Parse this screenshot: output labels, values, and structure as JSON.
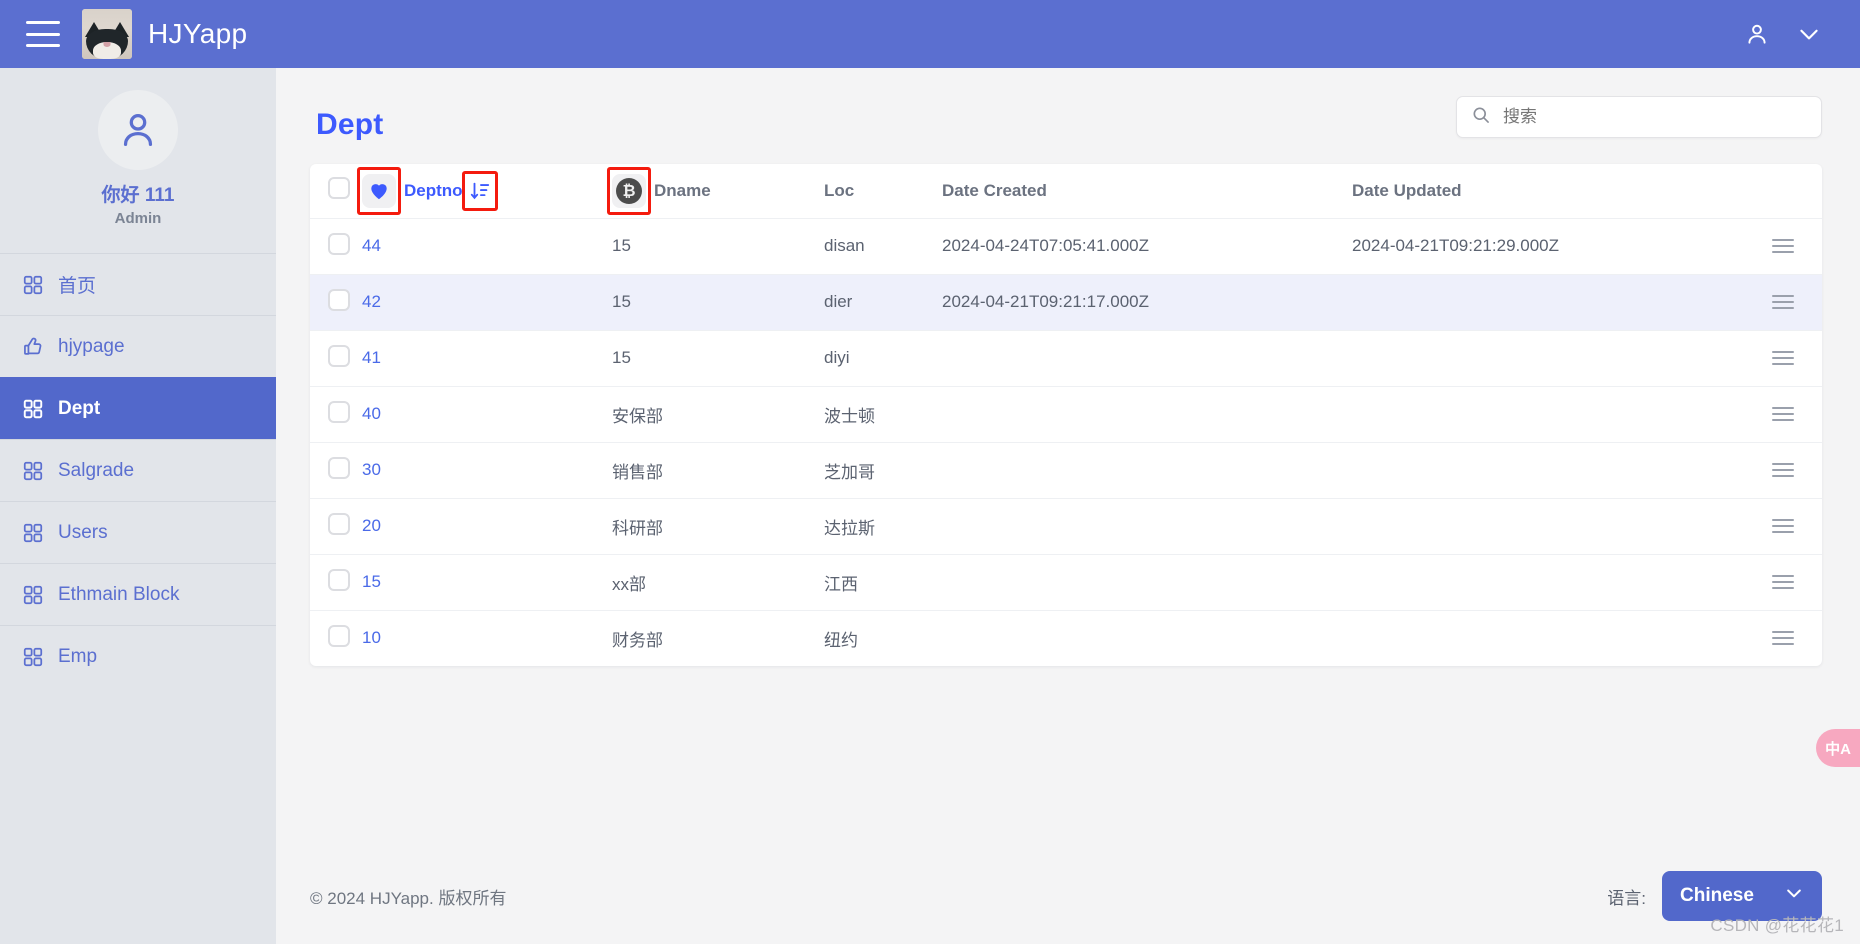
{
  "topbar": {
    "menu_icon": "hamburger-icon",
    "logo_alt": "cat-logo",
    "title": "HJYapp",
    "account_icon": "person-icon",
    "caret_icon": "chevron-down-icon"
  },
  "sidebar": {
    "avatar_icon": "person-icon",
    "user_name": "你好 111",
    "user_role": "Admin",
    "items": [
      {
        "label": "首页",
        "icon": "grid-icon",
        "active": false
      },
      {
        "label": "hjypage",
        "icon": "thumbs-up-icon",
        "active": false
      },
      {
        "label": "Dept",
        "icon": "grid-icon",
        "active": true
      },
      {
        "label": "Salgrade",
        "icon": "grid-icon",
        "active": false
      },
      {
        "label": "Users",
        "icon": "grid-icon",
        "active": false
      },
      {
        "label": "Ethmain Block",
        "icon": "grid-icon",
        "active": false
      },
      {
        "label": "Emp",
        "icon": "grid-icon",
        "active": false
      }
    ]
  },
  "page": {
    "title": "Dept"
  },
  "search": {
    "icon": "search-icon",
    "value": "",
    "placeholder": "搜索"
  },
  "table": {
    "select_all_checkbox": false,
    "header_heart_icon": "heart-icon",
    "header_sort_icon": "sort-descending-icon",
    "header_bitcoin_icon": "bitcoin-icon",
    "columns": [
      {
        "key": "deptno",
        "label": "Deptno"
      },
      {
        "key": "dname",
        "label": "Dname"
      },
      {
        "key": "loc",
        "label": "Loc"
      },
      {
        "key": "date_created",
        "label": "Date Created"
      },
      {
        "key": "date_updated",
        "label": "Date Updated"
      }
    ],
    "row_menu_icon": "list-menu-icon",
    "rows": [
      {
        "deptno": "44",
        "dname": "15",
        "loc": "disan",
        "date_created": "2024-04-24T07:05:41.000Z",
        "date_updated": "2024-04-21T09:21:29.000Z"
      },
      {
        "deptno": "42",
        "dname": "15",
        "loc": "dier",
        "date_created": "2024-04-21T09:21:17.000Z",
        "date_updated": ""
      },
      {
        "deptno": "41",
        "dname": "15",
        "loc": "diyi",
        "date_created": "",
        "date_updated": ""
      },
      {
        "deptno": "40",
        "dname": "安保部",
        "loc": "波士顿",
        "date_created": "",
        "date_updated": ""
      },
      {
        "deptno": "30",
        "dname": "销售部",
        "loc": "芝加哥",
        "date_created": "",
        "date_updated": ""
      },
      {
        "deptno": "20",
        "dname": "科研部",
        "loc": "达拉斯",
        "date_created": "",
        "date_updated": ""
      },
      {
        "deptno": "15",
        "dname": "xx部",
        "loc": "江西",
        "date_created": "",
        "date_updated": ""
      },
      {
        "deptno": "10",
        "dname": "财务部",
        "loc": "纽约",
        "date_created": "",
        "date_updated": ""
      }
    ]
  },
  "footer": {
    "copyright": "© 2024 HJYapp. 版权所有",
    "language_label": "语言:",
    "language_value": "Chinese",
    "language_caret_icon": "chevron-down-icon"
  },
  "floating": {
    "lang_toggle": "中A"
  },
  "watermark": "CSDN @花花花1",
  "colors": {
    "brand_blue": "#5268cb",
    "accent_blue": "#3d5afe",
    "link_blue": "#4a6ae8",
    "sidebar_bg": "#e2e5ea",
    "alt_row": "#eef0fb",
    "highlight_red": "#f41b0e"
  }
}
